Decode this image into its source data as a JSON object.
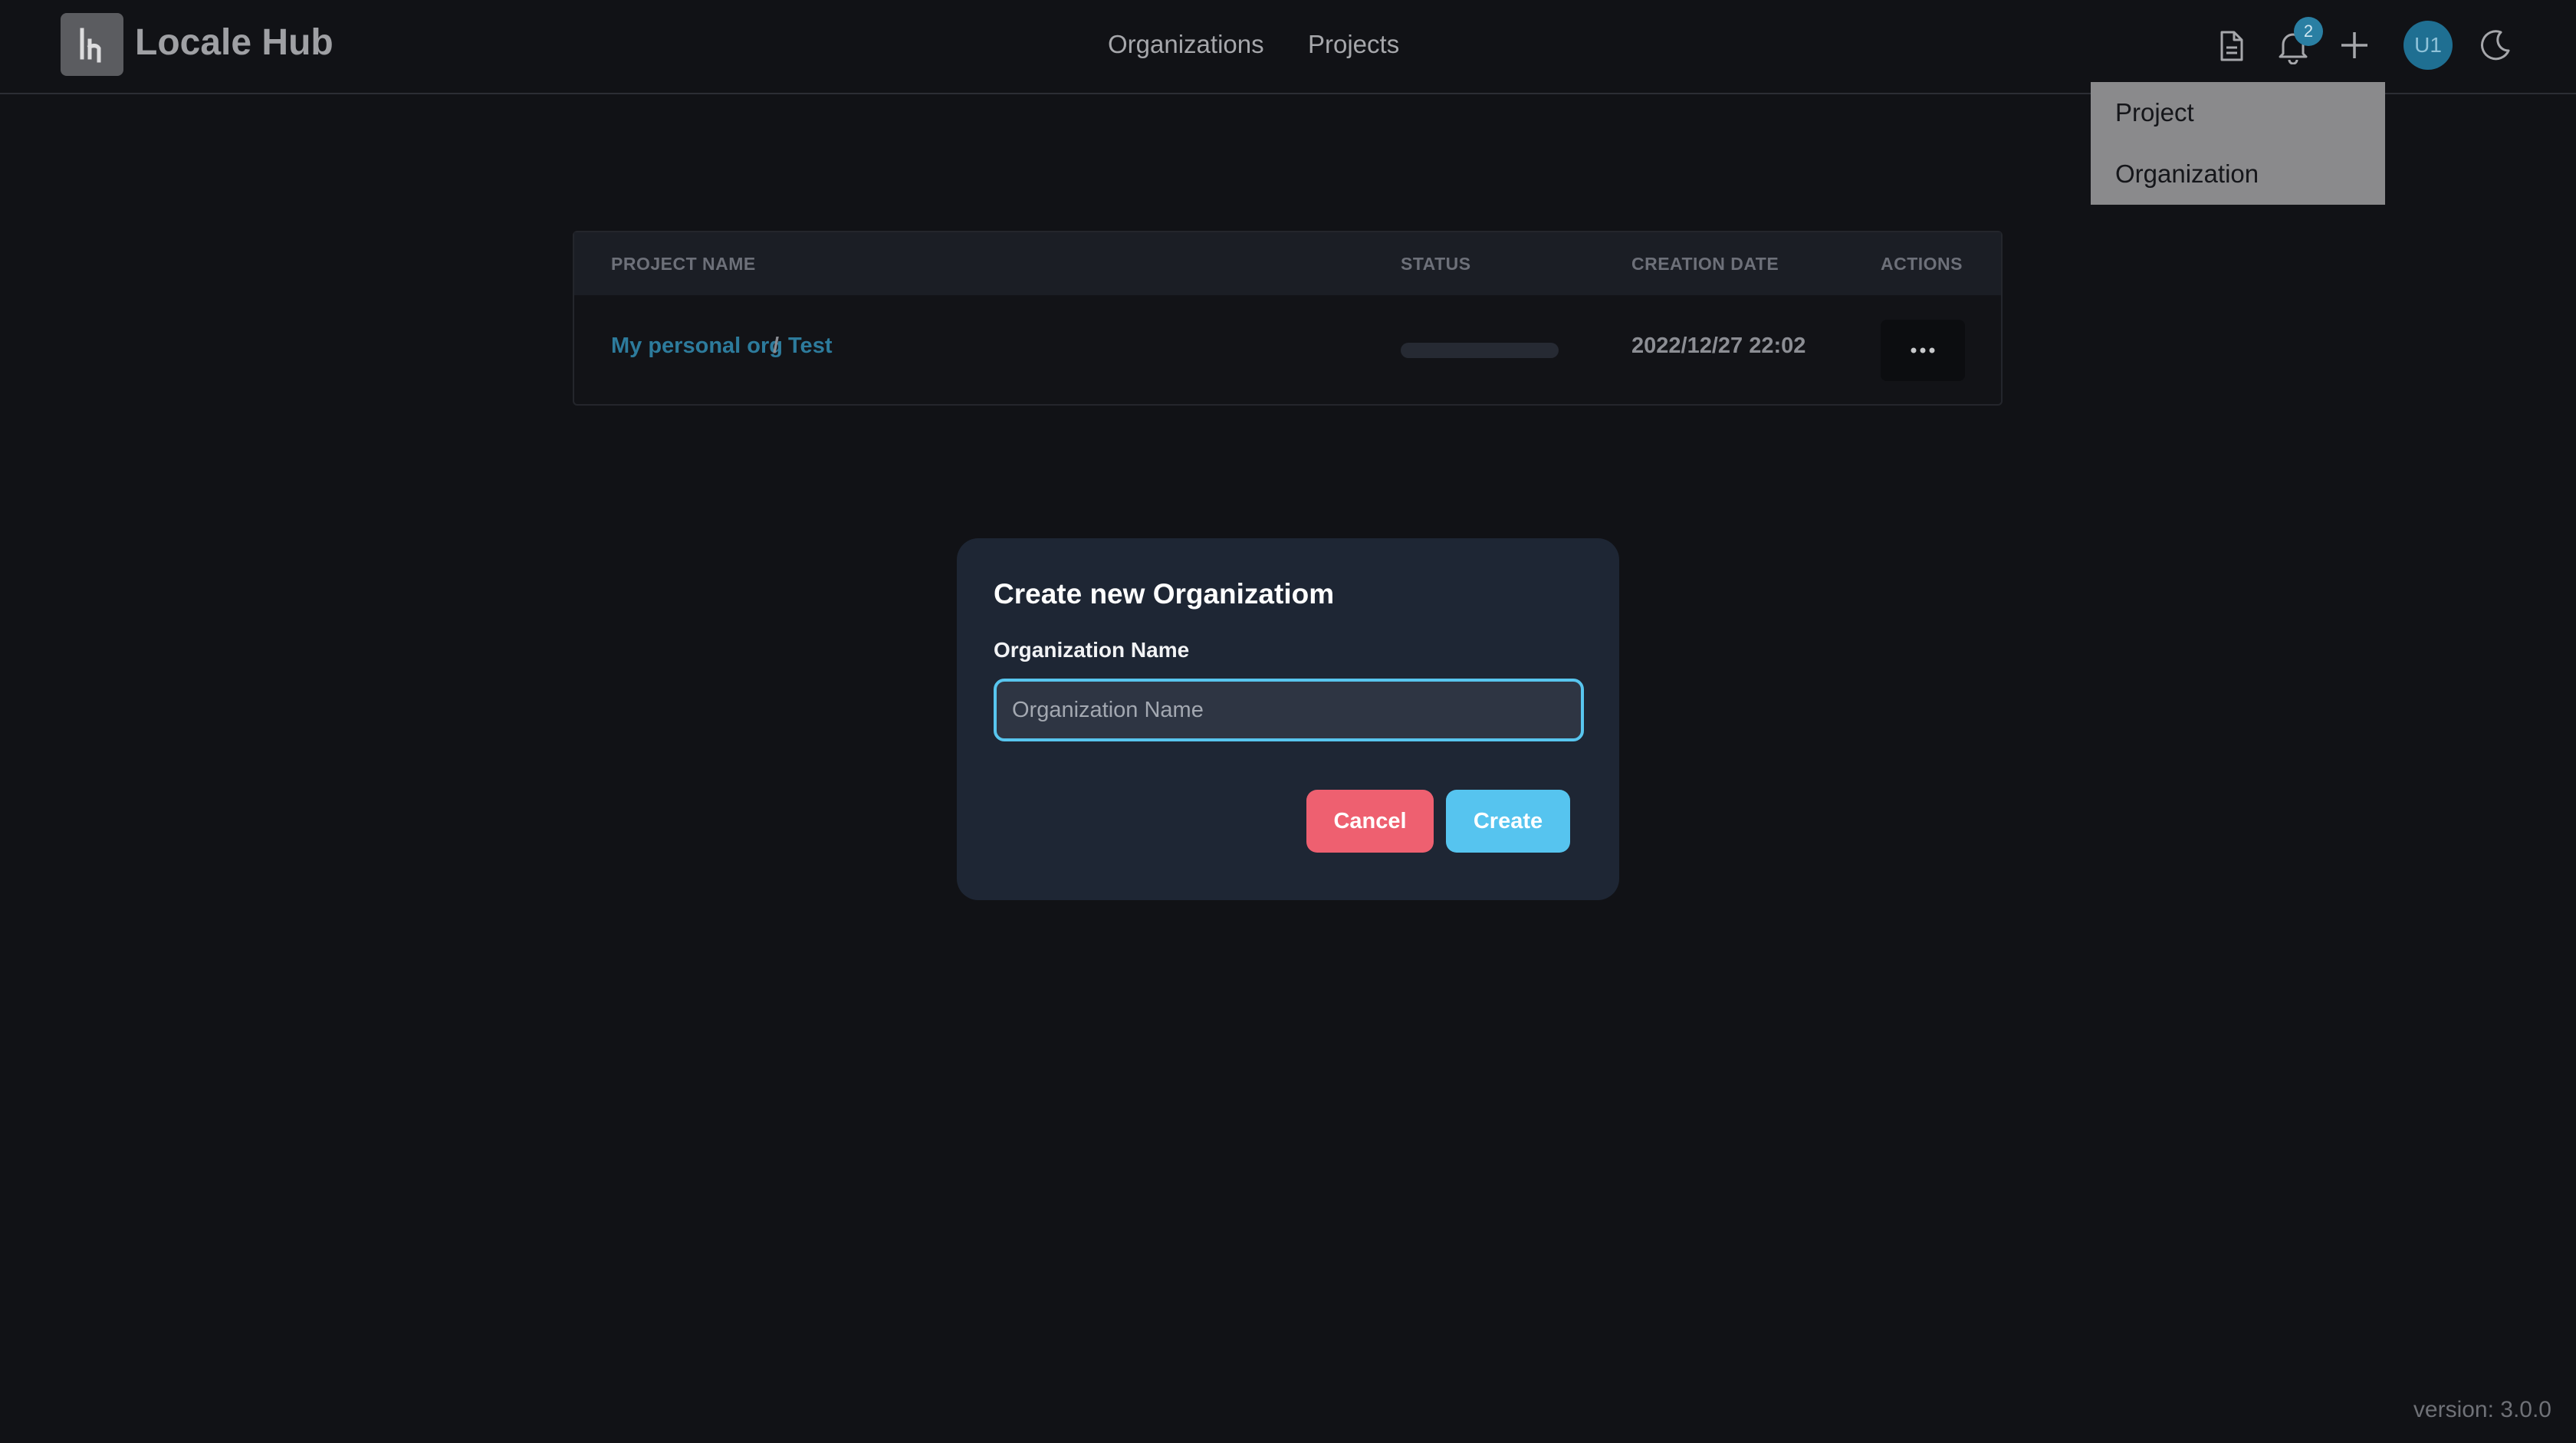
{
  "app": {
    "brand": "Locale Hub"
  },
  "nav": {
    "organizations": "Organizations",
    "projects": "Projects"
  },
  "header": {
    "notifications_count": "2",
    "avatar_initials": "U1",
    "icons": [
      "document-icon",
      "bell-icon",
      "plus-icon",
      "moon-icon"
    ]
  },
  "dropdown": {
    "items": [
      "Project",
      "Organization"
    ]
  },
  "table": {
    "columns": [
      "PROJECT NAME",
      "STATUS",
      "CREATION DATE",
      "ACTIONS"
    ],
    "rows": [
      {
        "org": "My personal org",
        "separator": "/",
        "project": "Test",
        "status_progress": 0,
        "created": "2022/12/27 22:02",
        "actions_label": "···"
      }
    ]
  },
  "modal": {
    "title": "Create new Organizatiom",
    "field_label": "Organization Name",
    "input_value": "",
    "input_placeholder": "Organization Name",
    "cancel_label": "Cancel",
    "create_label": "Create"
  },
  "footer": {
    "version": "version: 3.0.0"
  },
  "colors": {
    "accent": "#56c4ef",
    "danger": "#ee6070",
    "link": "#2d7b9c"
  }
}
